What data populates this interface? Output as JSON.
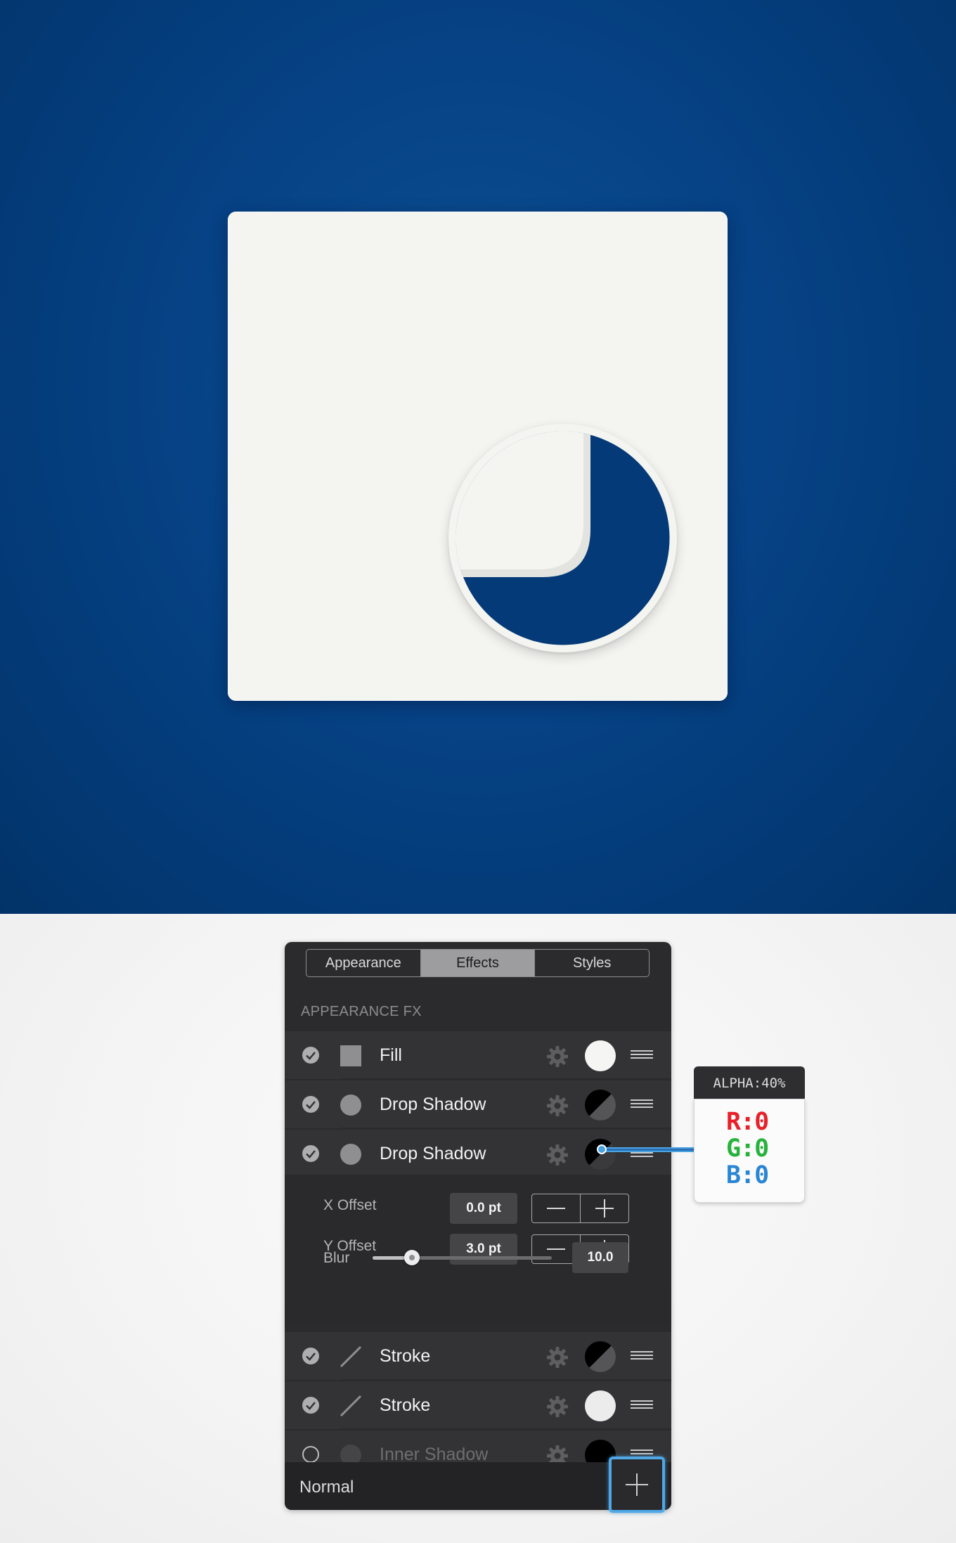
{
  "colors": {
    "canvas_blue": "#064285",
    "card_white": "#f4f5f1",
    "panel_bg": "#2b2b2d",
    "highlight_blue": "#4fa7e6"
  },
  "panel": {
    "tabs": [
      {
        "label": "Appearance",
        "active": false
      },
      {
        "label": "Effects",
        "active": true
      },
      {
        "label": "Styles",
        "active": false
      }
    ],
    "section_label": "APPEARANCE FX",
    "rows": [
      {
        "label": "Fill",
        "enabled": true,
        "icon": "square-fill-icon",
        "swatch": "#f5f5f3"
      },
      {
        "label": "Drop Shadow",
        "enabled": true,
        "icon": "circle-icon",
        "swatch": "black-split"
      },
      {
        "label": "Drop Shadow",
        "enabled": true,
        "icon": "circle-icon",
        "swatch": "black-translucent"
      },
      {
        "label": "Stroke",
        "enabled": true,
        "icon": "line-icon",
        "swatch": "black-split"
      },
      {
        "label": "Stroke",
        "enabled": true,
        "icon": "line-icon",
        "swatch": "#ececec"
      },
      {
        "label": "Inner Shadow",
        "enabled": false,
        "icon": "circle-icon",
        "swatch": "black"
      }
    ],
    "details": {
      "x_offset_label": "X Offset",
      "x_offset_value": "0.0 pt",
      "y_offset_label": "Y Offset",
      "y_offset_value": "3.0 pt",
      "blur_label": "Blur",
      "blur_value": "10.0",
      "blur_slider_fraction": 0.22
    },
    "footer": {
      "blend_mode": "Normal"
    }
  },
  "color_tooltip": {
    "alpha_label": "ALPHA:40%",
    "r": "R:0",
    "g": "G:0",
    "b": "B:0",
    "r_color": "#e8202a",
    "g_color": "#27b23c",
    "b_color": "#2a86d4"
  }
}
